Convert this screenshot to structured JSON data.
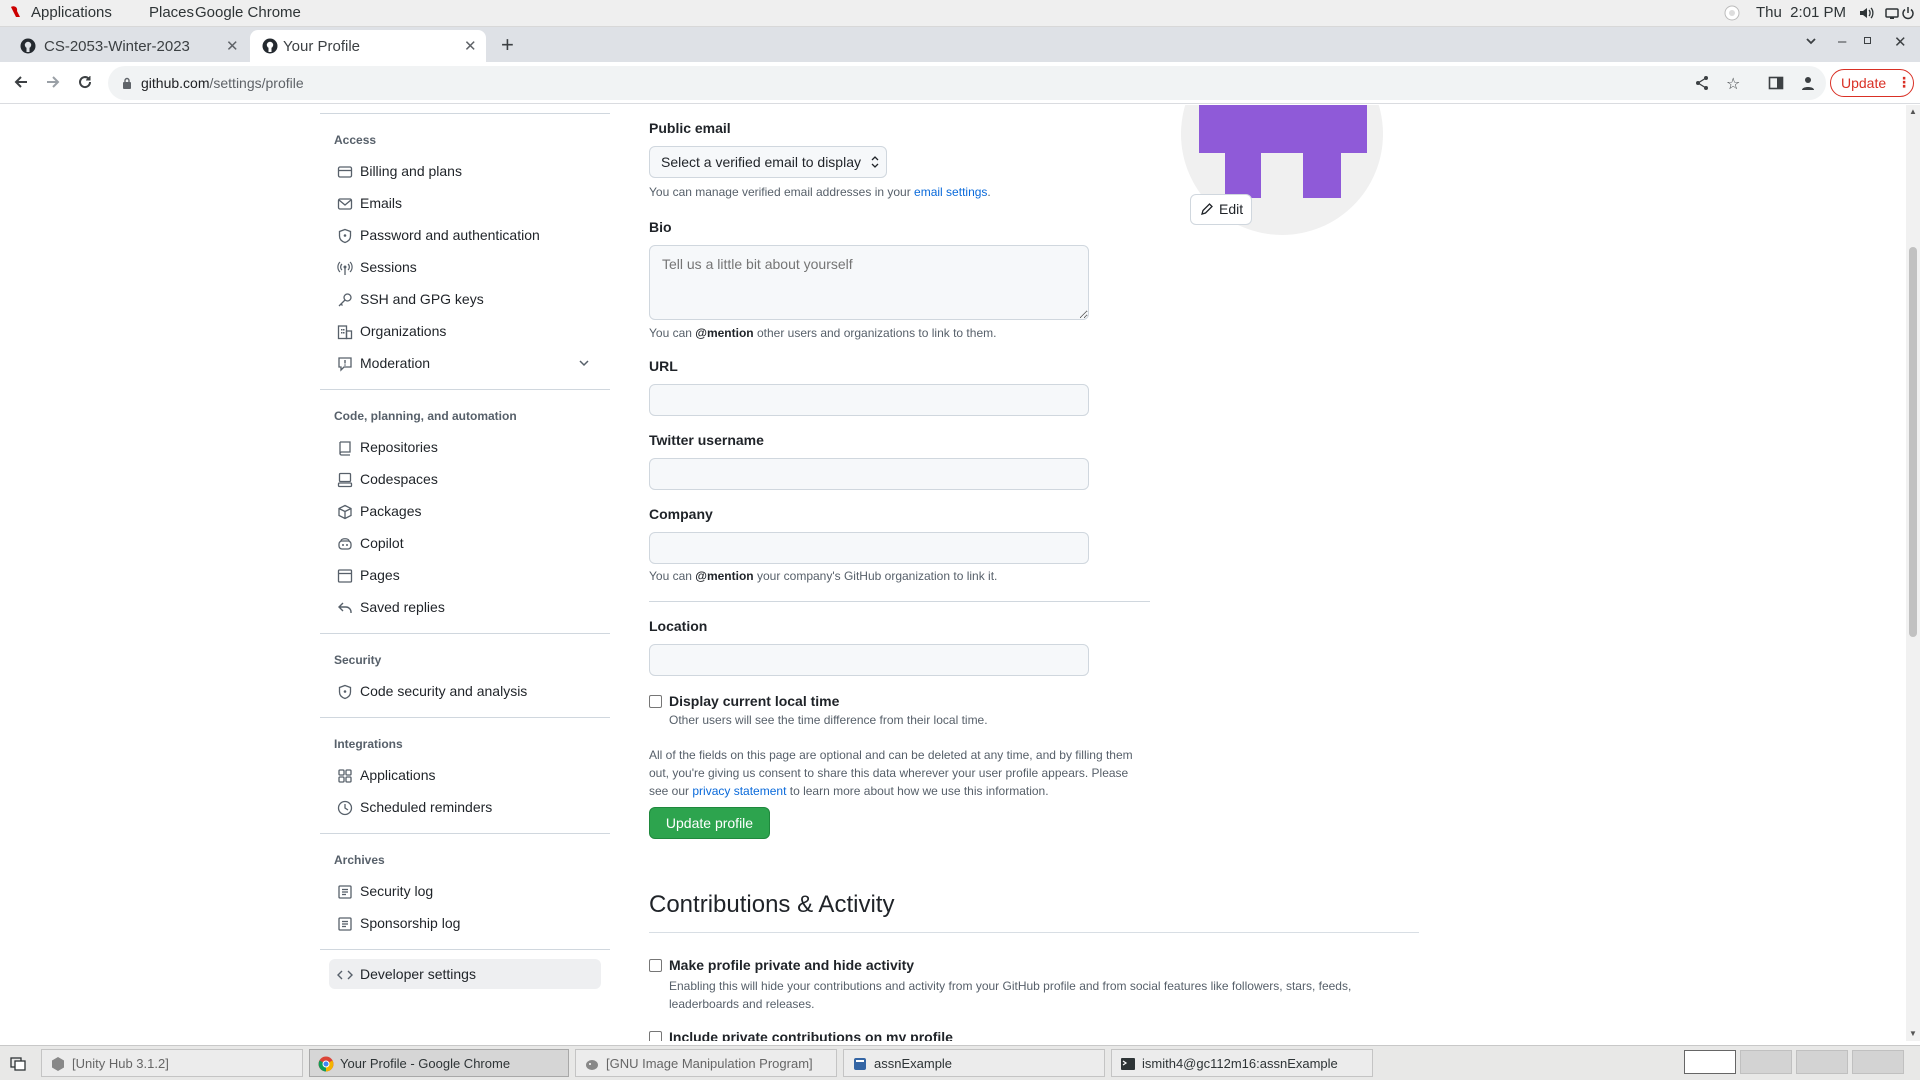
{
  "system_bar": {
    "menus": [
      "Applications",
      "Places",
      "Google Chrome"
    ],
    "clock": "Thu  2:01 PM"
  },
  "browser": {
    "tabs": [
      {
        "title": "CS-2053-Winter-2023",
        "active": false
      },
      {
        "title": "Your Profile",
        "active": true
      }
    ],
    "url_host": "github.com",
    "url_path": "/settings/profile",
    "update_label": "Update"
  },
  "sidebar": {
    "sections": [
      {
        "heading": "Access",
        "items": [
          "Billing and plans",
          "Emails",
          "Password and authentication",
          "Sessions",
          "SSH and GPG keys",
          "Organizations",
          "Moderation"
        ]
      },
      {
        "heading": "Code, planning, and automation",
        "items": [
          "Repositories",
          "Codespaces",
          "Packages",
          "Copilot",
          "Pages",
          "Saved replies"
        ]
      },
      {
        "heading": "Security",
        "items": [
          "Code security and analysis"
        ]
      },
      {
        "heading": "Integrations",
        "items": [
          "Applications",
          "Scheduled reminders"
        ]
      },
      {
        "heading": "Archives",
        "items": [
          "Security log",
          "Sponsorship log"
        ]
      }
    ],
    "developer_settings": "Developer settings"
  },
  "profile_form": {
    "public_email_label": "Public email",
    "public_email_select": "Select a verified email to display",
    "public_email_note_pre": "You can manage verified email addresses in your ",
    "public_email_note_link": "email settings",
    "public_email_note_post": ".",
    "bio_label": "Bio",
    "bio_placeholder": "Tell us a little bit about yourself",
    "bio_note_pre": "You can ",
    "bio_note_bold": "@mention",
    "bio_note_post": " other users and organizations to link to them.",
    "url_label": "URL",
    "url_value": "",
    "twitter_label": "Twitter username",
    "twitter_value": "",
    "company_label": "Company",
    "company_value": "",
    "company_note_pre": "You can ",
    "company_note_bold": "@mention",
    "company_note_post": " your company's GitHub organization to link it.",
    "location_label": "Location",
    "location_value": "",
    "local_time_label": "Display current local time",
    "local_time_checked": false,
    "local_time_note": "Other users will see the time difference from their local time.",
    "consent_line1": "All of the fields on this page are optional and can be deleted at any time, and by filling them",
    "consent_line2": "out, you're giving us consent to share this data wherever your user profile appears. Please",
    "consent_line3_pre": "see our ",
    "consent_line3_link": "privacy statement",
    "consent_line3_post": " to learn more about how we use this information.",
    "update_button": "Update profile"
  },
  "avatar": {
    "edit_label": "Edit",
    "color": "#8f5ad8"
  },
  "contributions": {
    "heading": "Contributions & Activity",
    "private_label": "Make profile private and hide activity",
    "private_checked": false,
    "private_note_line1": "Enabling this will hide your contributions and activity from your GitHub profile and from social features like followers, stars, feeds,",
    "private_note_line2": "leaderboards and releases.",
    "include_private_label": "Include private contributions on my profile",
    "include_private_checked": false
  },
  "taskbar": {
    "tasks": [
      {
        "label": "[Unity Hub 3.1.2]",
        "active": false
      },
      {
        "label": "Your Profile - Google Chrome",
        "active": true
      },
      {
        "label": "[GNU Image Manipulation Program]",
        "active": false
      },
      {
        "label": "assnExample",
        "active": false
      },
      {
        "label": "ismith4@gc112m16:assnExample",
        "active": false
      }
    ]
  },
  "colors": {
    "primary_button": "#2da44e",
    "link": "#0969da",
    "update_red": "#d93025"
  }
}
